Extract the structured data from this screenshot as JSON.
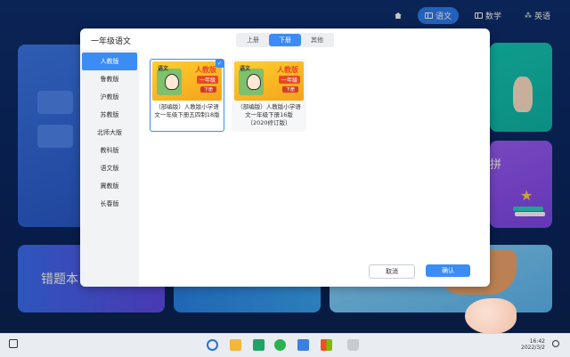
{
  "topnav": {
    "items": [
      {
        "icon": "home-icon",
        "label": ""
      },
      {
        "icon": "book-icon",
        "label": "语文"
      },
      {
        "icon": "math-icon",
        "label": "数学"
      },
      {
        "icon": "english-icon",
        "label": "英语"
      }
    ],
    "active_index": 1
  },
  "background": {
    "wrong_book_label": "错题本",
    "right_card_label": "拼"
  },
  "dialog": {
    "title": "一年级语文",
    "segments": [
      "上册",
      "下册",
      "其他"
    ],
    "active_segment": 1,
    "editions": [
      "人教版",
      "鲁教版",
      "沪教版",
      "苏教版",
      "北师大版",
      "教科版",
      "语文版",
      "冀教版",
      "长春版"
    ],
    "active_edition": 0,
    "books": [
      {
        "title": "（部编版）人教版小学语文一年级下册五四制18版",
        "cover_top": "语文",
        "cover_t1": "人教版",
        "cover_t2": "一年级",
        "cover_t3": "下册",
        "selected": true
      },
      {
        "title": "（部编版）人教版小学语文一年级下册16版（2020修订版）",
        "cover_top": "语文",
        "cover_t1": "人教版",
        "cover_t2": "一年级",
        "cover_t3": "下册",
        "selected": false
      }
    ],
    "cancel_label": "取消",
    "ok_label": "确认"
  },
  "taskbar": {
    "time": "16:42",
    "date": "2022/3/2",
    "apps": [
      "search-icon",
      "folder-icon",
      "mail-icon",
      "wechat-icon",
      "store-icon",
      "apps-icon",
      "recycle-icon"
    ]
  },
  "colors": {
    "accent": "#3b8cf5",
    "background": "#0e2f6e"
  }
}
